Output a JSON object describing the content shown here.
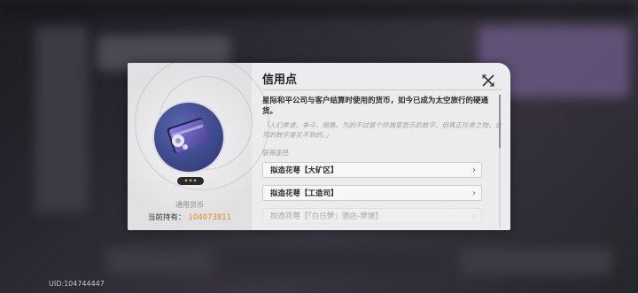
{
  "footer": {
    "uid": "UID:104744447"
  },
  "panel": {
    "title": "信用点",
    "description": "星际和平公司与客户结算时使用的货币，如今已成为太空旅行的硬通货。",
    "quote": "「人们奔波、争斗、倒悬，为的不过是个终端里显示的数字。但真正珍贵之物，公司的数字是买不到的。」",
    "acquire_label": "获得途径",
    "item_type": "通用货币",
    "holding_label": "当前持有：",
    "holding_value": "104073811",
    "rarity_stars": "✦✦✦",
    "routes": [
      {
        "label": "拟造花萼【大矿区】"
      },
      {
        "label": "拟造花萼【工造司】"
      },
      {
        "label": "拟造花萼【「白日梦」酒店-梦境】"
      }
    ],
    "chevron": "›"
  },
  "colors": {
    "panel_bg": "#ececee",
    "holding_value": "#e0861c",
    "item_circle": "#3f4a8c"
  }
}
